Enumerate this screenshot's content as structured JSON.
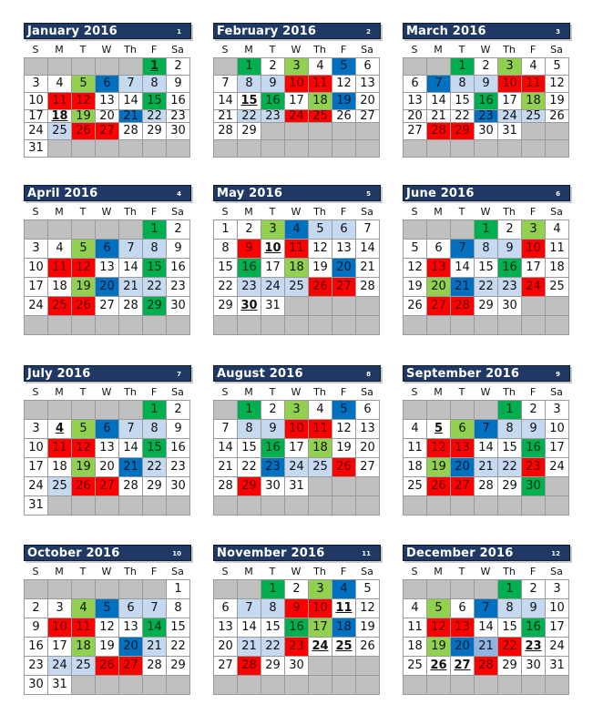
{
  "year": 2016,
  "weekday_labels": [
    "S",
    "M",
    "T",
    "W",
    "Th",
    "F",
    "Sa"
  ],
  "legend_colors": {
    "red": "#ff0000",
    "dkgreen": "#00b050",
    "ltgreen": "#92d050",
    "blue": "#0070c0",
    "ltblue": "#c5d9f1",
    "mdblue": "#8db4e2",
    "empty": "#c0c0c0",
    "header": "#1f3864"
  },
  "months": [
    {
      "title": "January 2016",
      "num": "1",
      "start": 5,
      "days": 31,
      "rows": 6,
      "colors": {
        "1": "dkgreen",
        "5": "ltgreen",
        "6": "blue",
        "7": "ltblue",
        "8": "ltblue",
        "11": "red",
        "12": "red",
        "15": "dkgreen",
        "19": "ltgreen",
        "21": "blue",
        "22": "ltblue",
        "25": "ltblue",
        "26": "red",
        "27": "red"
      },
      "underline": [
        1,
        18
      ]
    },
    {
      "title": "February 2016",
      "num": "2",
      "start": 1,
      "days": 29,
      "rows": 6,
      "colors": {
        "1": "dkgreen",
        "3": "ltgreen",
        "5": "blue",
        "8": "ltblue",
        "9": "ltblue",
        "10": "red",
        "11": "red",
        "16": "dkgreen",
        "18": "ltgreen",
        "19": "blue",
        "22": "ltblue",
        "23": "ltblue",
        "24": "red",
        "25": "red"
      },
      "underline": [
        15
      ]
    },
    {
      "title": "March 2016",
      "num": "3",
      "start": 2,
      "days": 31,
      "rows": 6,
      "colors": {
        "1": "dkgreen",
        "3": "ltgreen",
        "7": "blue",
        "8": "ltblue",
        "9": "ltblue",
        "10": "red",
        "11": "red",
        "16": "dkgreen",
        "18": "ltgreen",
        "23": "blue",
        "24": "ltblue",
        "25": "ltblue",
        "28": "red",
        "29": "red"
      },
      "underline": []
    },
    {
      "title": "April 2016",
      "num": "4",
      "start": 5,
      "days": 30,
      "rows": 6,
      "colors": {
        "1": "dkgreen",
        "5": "ltgreen",
        "6": "blue",
        "7": "ltblue",
        "8": "ltblue",
        "11": "red",
        "12": "red",
        "15": "dkgreen",
        "19": "ltgreen",
        "20": "blue",
        "21": "ltblue",
        "22": "ltblue",
        "25": "red",
        "26": "red",
        "29": "dkgreen"
      },
      "underline": []
    },
    {
      "title": "May 2016",
      "num": "5",
      "start": 0,
      "days": 31,
      "rows": 6,
      "colors": {
        "3": "ltgreen",
        "4": "blue",
        "5": "ltblue",
        "6": "ltblue",
        "9": "red",
        "11": "red",
        "16": "dkgreen",
        "18": "ltgreen",
        "20": "blue",
        "23": "ltblue",
        "24": "ltblue",
        "25": "ltblue",
        "26": "red",
        "27": "red"
      },
      "underline": [
        10,
        30
      ]
    },
    {
      "title": "June 2016",
      "num": "6",
      "start": 3,
      "days": 30,
      "rows": 6,
      "colors": {
        "1": "dkgreen",
        "3": "ltgreen",
        "7": "blue",
        "8": "ltblue",
        "9": "ltblue",
        "10": "red",
        "13": "red",
        "16": "dkgreen",
        "20": "ltgreen",
        "21": "blue",
        "22": "ltblue",
        "23": "ltblue",
        "24": "red",
        "27": "red",
        "28": "red"
      },
      "underline": []
    },
    {
      "title": "July 2016",
      "num": "7",
      "start": 5,
      "days": 31,
      "rows": 6,
      "colors": {
        "1": "dkgreen",
        "5": "ltgreen",
        "6": "blue",
        "7": "ltblue",
        "8": "ltblue",
        "11": "red",
        "12": "red",
        "15": "dkgreen",
        "19": "ltgreen",
        "21": "blue",
        "22": "ltblue",
        "25": "ltblue",
        "26": "red",
        "27": "red"
      },
      "underline": [
        4
      ]
    },
    {
      "title": "August 2016",
      "num": "8",
      "start": 1,
      "days": 31,
      "rows": 6,
      "colors": {
        "1": "dkgreen",
        "3": "ltgreen",
        "5": "blue",
        "8": "ltblue",
        "9": "ltblue",
        "10": "red",
        "11": "red",
        "16": "dkgreen",
        "18": "ltgreen",
        "23": "blue",
        "24": "ltblue",
        "25": "ltblue",
        "26": "red",
        "29": "red"
      },
      "underline": []
    },
    {
      "title": "September 2016",
      "num": "9",
      "start": 4,
      "days": 30,
      "rows": 6,
      "colors": {
        "1": "dkgreen",
        "6": "ltgreen",
        "7": "blue",
        "8": "ltblue",
        "9": "ltblue",
        "12": "red",
        "13": "red",
        "16": "dkgreen",
        "19": "ltgreen",
        "20": "blue",
        "21": "ltblue",
        "22": "ltblue",
        "23": "red",
        "26": "red",
        "27": "red",
        "30": "dkgreen"
      },
      "underline": [
        5
      ]
    },
    {
      "title": "October 2016",
      "num": "10",
      "start": 6,
      "days": 31,
      "rows": 6,
      "colors": {
        "4": "ltgreen",
        "5": "blue",
        "6": "ltblue",
        "7": "ltblue",
        "10": "red",
        "11": "red",
        "14": "dkgreen",
        "18": "ltgreen",
        "20": "blue",
        "21": "ltblue",
        "24": "ltblue",
        "25": "ltblue",
        "26": "red",
        "27": "red"
      },
      "underline": []
    },
    {
      "title": "November 2016",
      "num": "11",
      "start": 2,
      "days": 30,
      "rows": 6,
      "colors": {
        "1": "dkgreen",
        "3": "ltgreen",
        "4": "blue",
        "7": "ltblue",
        "8": "ltblue",
        "9": "red",
        "10": "red",
        "16": "dkgreen",
        "17": "ltgreen",
        "18": "blue",
        "21": "ltblue",
        "22": "ltblue",
        "23": "red",
        "28": "red"
      },
      "underline": [
        11,
        24,
        25
      ]
    },
    {
      "title": "December 2016",
      "num": "12",
      "start": 4,
      "days": 31,
      "rows": 6,
      "colors": {
        "1": "dkgreen",
        "5": "ltgreen",
        "7": "blue",
        "8": "ltblue",
        "9": "ltblue",
        "12": "red",
        "13": "red",
        "16": "dkgreen",
        "19": "ltgreen",
        "20": "blue",
        "21": "mdblue",
        "22": "red",
        "28": "red"
      },
      "underline": [
        23,
        26,
        27
      ]
    }
  ]
}
